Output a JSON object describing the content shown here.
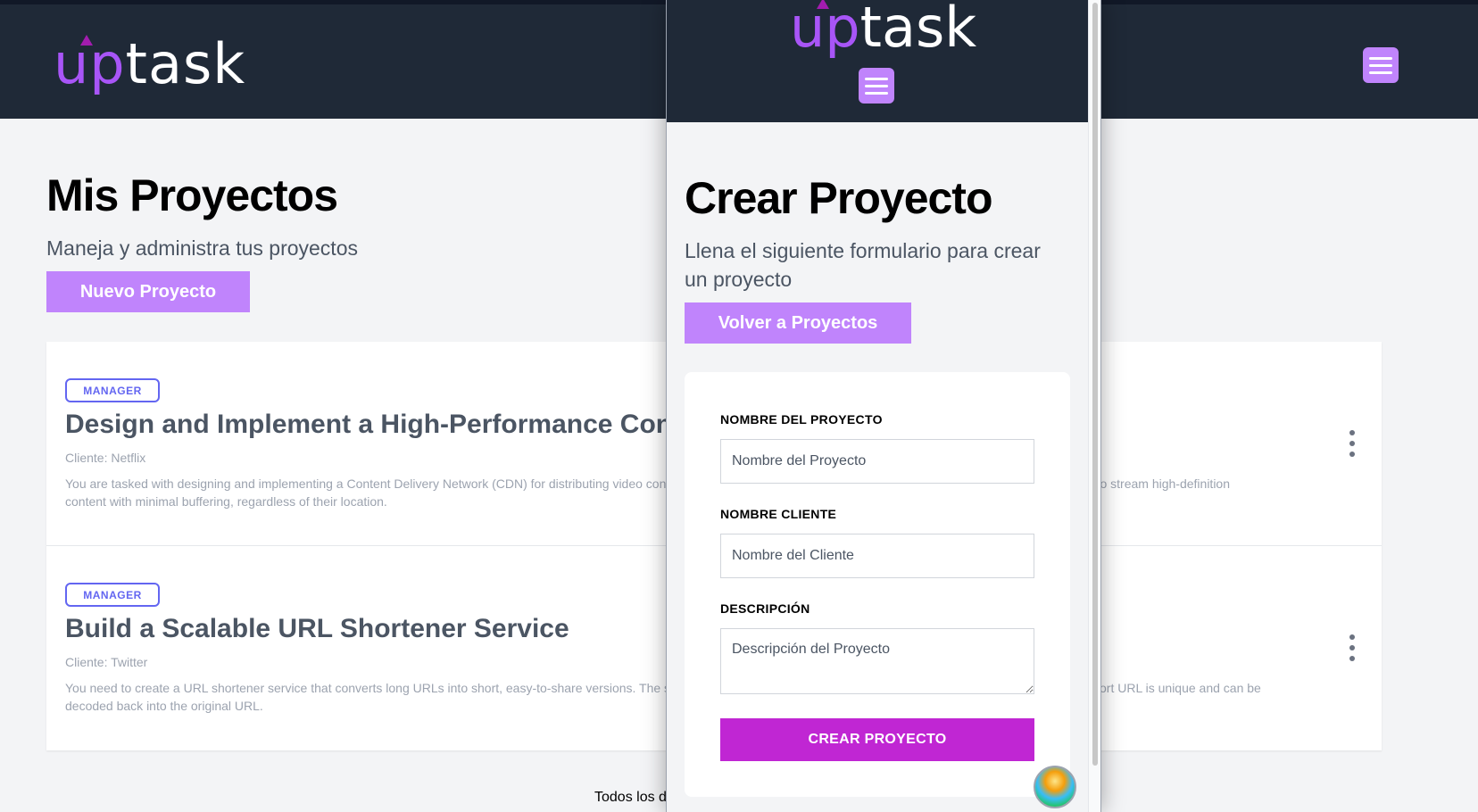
{
  "brand": {
    "logo_up": "up",
    "logo_rest": "task"
  },
  "colors": {
    "header": "#1f2937",
    "accent": "#c084fc",
    "submit": "#c026d3",
    "badge": "#6366f1"
  },
  "background": {
    "page_title": "Mis Proyectos",
    "page_subtitle": "Maneja y administra tus proyectos",
    "new_project_label": "Nuevo Proyecto",
    "menu_icon": "hamburger-icon",
    "projects": [
      {
        "role": "MANAGER",
        "name": "Design and Implement a High-Performance Content Delivery Network (CDN)",
        "client": "Cliente: Netflix",
        "description": "You are tasked with designing and implementing a Content Delivery Network (CDN) for distributing video content to users around the world. The CDN should allow users around the world to stream high-definition content with minimal buffering, regardless of their location."
      },
      {
        "role": "MANAGER",
        "name": "Build a Scalable URL Shortener Service",
        "client": "Cliente: Twitter",
        "description": "You need to create a URL shortener service that converts long URLs into short, easy-to-share versions. The service should handle a high volume of requests and must ensure that each short URL is unique and can be decoded back into the original URL."
      }
    ],
    "footer_text": "Todos los derechos reservados"
  },
  "foreground": {
    "page_title": "Crear Proyecto",
    "page_subtitle": "Llena el siguiente formulario para crear un proyecto",
    "back_label": "Volver a Proyectos",
    "menu_icon": "hamburger-icon",
    "form": {
      "project_name_label": "NOMBRE DEL PROYECTO",
      "project_name_placeholder": "Nombre del Proyecto",
      "client_label": "NOMBRE CLIENTE",
      "client_placeholder": "Nombre del Cliente",
      "description_label": "DESCRIPCIÓN",
      "description_placeholder": "Descripción del Proyecto",
      "submit_label": "CREAR PROYECTO"
    }
  }
}
